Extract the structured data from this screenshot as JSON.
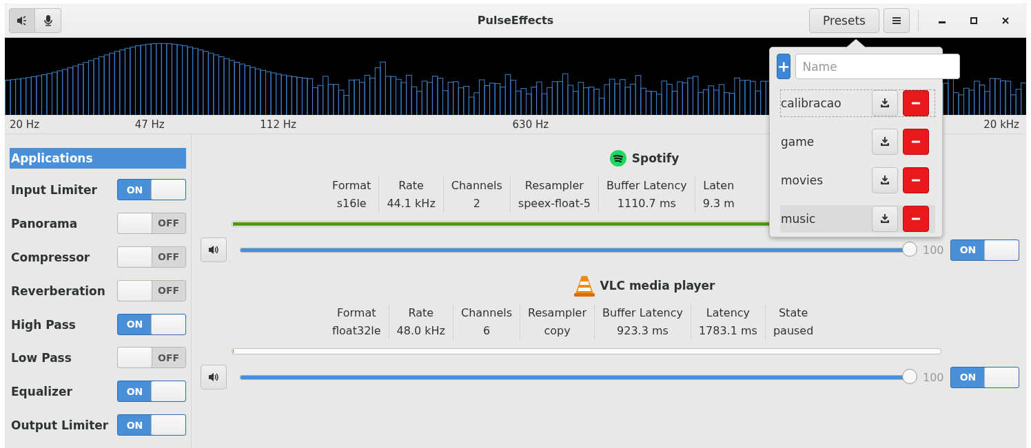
{
  "window": {
    "title": "PulseEffects"
  },
  "header": {
    "mode_buttons": [
      {
        "kind": "speaker",
        "selected": true
      },
      {
        "kind": "microphone",
        "selected": false
      }
    ],
    "presets_button": "Presets"
  },
  "spectrum": {
    "labels": [
      "20 Hz",
      "47 Hz",
      "112 Hz",
      "630 Hz",
      "20 kHz"
    ]
  },
  "sidebar": {
    "items": [
      {
        "kind": "header",
        "label": "Applications",
        "selected": true
      },
      {
        "kind": "toggle",
        "label": "Input Limiter",
        "on": true,
        "switch": "ON"
      },
      {
        "kind": "toggle",
        "label": "Panorama",
        "on": false,
        "switch": "OFF"
      },
      {
        "kind": "toggle",
        "label": "Compressor",
        "on": false,
        "switch": "OFF"
      },
      {
        "kind": "toggle",
        "label": "Reverberation",
        "on": false,
        "switch": "OFF"
      },
      {
        "kind": "toggle",
        "label": "High Pass",
        "on": true,
        "switch": "ON"
      },
      {
        "kind": "toggle",
        "label": "Low Pass",
        "on": false,
        "switch": "OFF"
      },
      {
        "kind": "toggle",
        "label": "Equalizer",
        "on": true,
        "switch": "ON"
      },
      {
        "kind": "toggle",
        "label": "Output Limiter",
        "on": true,
        "switch": "ON"
      }
    ]
  },
  "apps": [
    {
      "name": "Spotify",
      "kind": "music",
      "fields": [
        {
          "label": "Format",
          "value": "s16le"
        },
        {
          "label": "Rate",
          "value": "44.1 kHz"
        },
        {
          "label": "Channels",
          "value": "2"
        },
        {
          "label": "Resampler",
          "value": "speex-float-5"
        },
        {
          "label": "Buffer Latency",
          "value": "1110.7 ms"
        },
        {
          "label": "Laten",
          "value": "9.3 m"
        }
      ],
      "meter": {
        "level": 1.0
      },
      "volume": {
        "level": 1.0,
        "reading": "100"
      },
      "on": true,
      "switch": "ON"
    },
    {
      "name": "VLC media player",
      "kind": "cone",
      "fields": [
        {
          "label": "Format",
          "value": "float32le"
        },
        {
          "label": "Rate",
          "value": "48.0 kHz"
        },
        {
          "label": "Channels",
          "value": "6"
        },
        {
          "label": "Resampler",
          "value": "copy"
        },
        {
          "label": "Buffer Latency",
          "value": "923.3 ms"
        },
        {
          "label": "Latency",
          "value": "1783.1 ms"
        },
        {
          "label": "State",
          "value": "paused"
        }
      ],
      "meter": {
        "level": 0.0
      },
      "volume": {
        "level": 1.0,
        "reading": "100"
      },
      "on": true,
      "switch": "ON"
    }
  ],
  "presets_popover": {
    "add_button": "+",
    "name_field": {
      "placeholder": "Name"
    },
    "presets": [
      {
        "name": "calibracao",
        "focused": true,
        "selected": false
      },
      {
        "name": "game",
        "focused": false,
        "selected": false
      },
      {
        "name": "movies",
        "focused": false,
        "selected": false
      },
      {
        "name": "music",
        "focused": false,
        "selected": true
      }
    ]
  }
}
